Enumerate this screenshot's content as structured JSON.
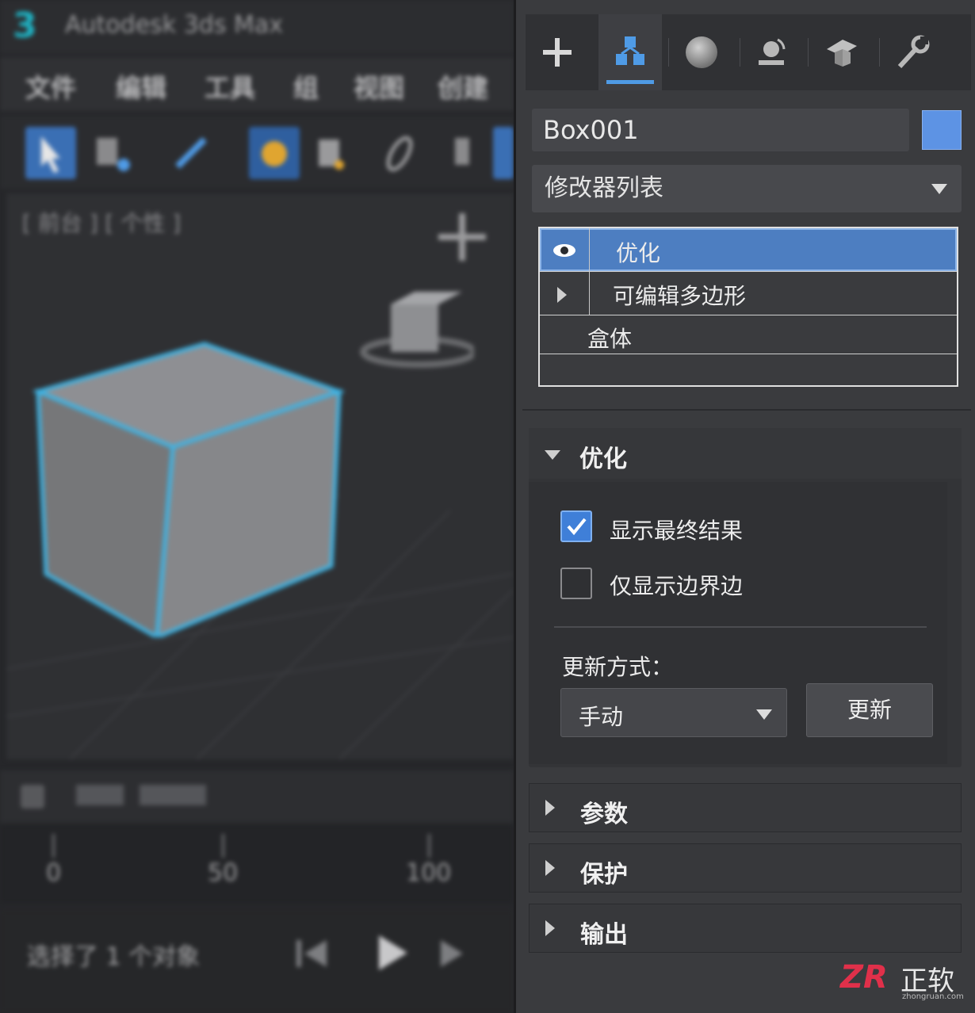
{
  "app": {
    "title": "Autodesk 3ds Max",
    "logo": "3"
  },
  "menu": [
    "文件",
    "编辑",
    "工具",
    "组",
    "视图",
    "创建"
  ],
  "viewport": {
    "labels": "[ 前台 ] [ 个性 ]"
  },
  "timeline": {
    "ticks": [
      "0",
      "50",
      "100"
    ]
  },
  "status": {
    "text": "选择了 1 个对象"
  },
  "command_panel": {
    "tabs": [
      {
        "name": "create",
        "icon": "plus-icon"
      },
      {
        "name": "modify",
        "icon": "modify-hierarchy-icon",
        "active": true
      },
      {
        "name": "hierarchy",
        "icon": "sphere-icon"
      },
      {
        "name": "motion",
        "icon": "motion-icon"
      },
      {
        "name": "display",
        "icon": "display-icon"
      },
      {
        "name": "utilities",
        "icon": "wrench-icon"
      }
    ],
    "object_name": "Box001",
    "object_color": "#5d93e4",
    "modifier_list_label": "修改器列表",
    "stack": [
      {
        "label": "优化",
        "selected": true,
        "icon": "eye-icon"
      },
      {
        "label": "可编辑多边形",
        "icon": "expand-arrow-icon"
      },
      {
        "label": "盒体"
      }
    ]
  },
  "rollout_optimize": {
    "title": "优化",
    "show_final_result": {
      "label": "显示最终结果",
      "checked": true
    },
    "show_boundary_only": {
      "label": "仅显示边界边",
      "checked": false
    },
    "update_mode_label": "更新方式：",
    "update_mode_value": "手动",
    "update_button": "更新"
  },
  "rollouts_collapsed": [
    "参数",
    "保护",
    "输出"
  ],
  "watermark": {
    "logo": "ZR",
    "text": "正软",
    "url": "zhongruan.com"
  }
}
